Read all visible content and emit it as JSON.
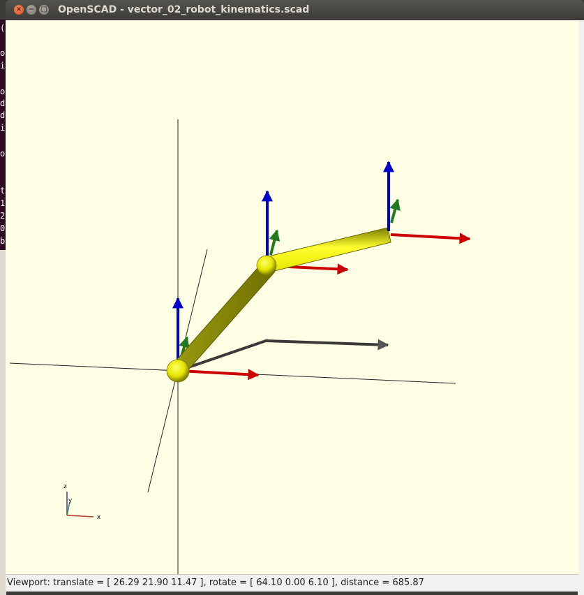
{
  "window": {
    "title": "OpenSCAD - vector_02_robot_kinematics.scad",
    "buttons": {
      "close": "×",
      "minimize": "−",
      "maximize": "□"
    }
  },
  "status_bar": {
    "text": "Viewport: translate = [ 26.29 21.90 11.47 ], rotate = [ 64.10 0.00 6.10 ], distance = 685.87"
  },
  "axes_indicator": {
    "x": "x",
    "y": "y",
    "z": "z"
  },
  "background_terminal": {
    "chars": [
      "(",
      "o",
      "i",
      "o",
      "d",
      "d",
      "i",
      "o",
      "t",
      "1",
      "2",
      "0",
      "b"
    ]
  },
  "colors": {
    "viewport_bg": "#ffffe5",
    "link": "#e6e600",
    "x_arrow": "#cc0000",
    "y_arrow": "#1f7a1f",
    "z_arrow": "#0000cc",
    "target_arrow": "#333333"
  },
  "icons": [
    "close-icon",
    "minimize-icon",
    "maximize-icon"
  ]
}
